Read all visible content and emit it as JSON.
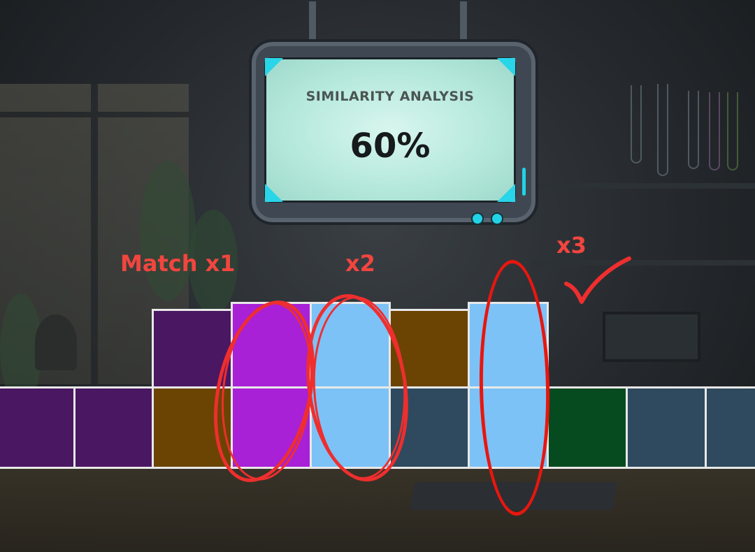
{
  "monitor": {
    "title": "SIMILARITY ANALYSIS",
    "value": "60%"
  },
  "annotations": {
    "match1": "Match x1",
    "match2": "x2",
    "match3": "x3"
  },
  "palette": {
    "dark_purple": "#4a1762",
    "purple": "#a821d6",
    "light_blue": "#7cc2f7",
    "brown": "#6b4404",
    "slate": "#2f4a5e",
    "dark_green": "#064a1f",
    "tile_border": "#e8e8e8",
    "annotation_red": "#ef2e2e",
    "screen_accent": "#29d5e8"
  },
  "top_row": [
    "dark_purple",
    "purple",
    "light_blue",
    "brown",
    "light_blue"
  ],
  "bottom_row": [
    "dark_purple",
    "dark_purple",
    "brown",
    "purple",
    "light_blue",
    "slate",
    "light_blue",
    "dark_green",
    "slate",
    "slate"
  ],
  "icons": [
    "checkmark-icon",
    "led-light"
  ]
}
